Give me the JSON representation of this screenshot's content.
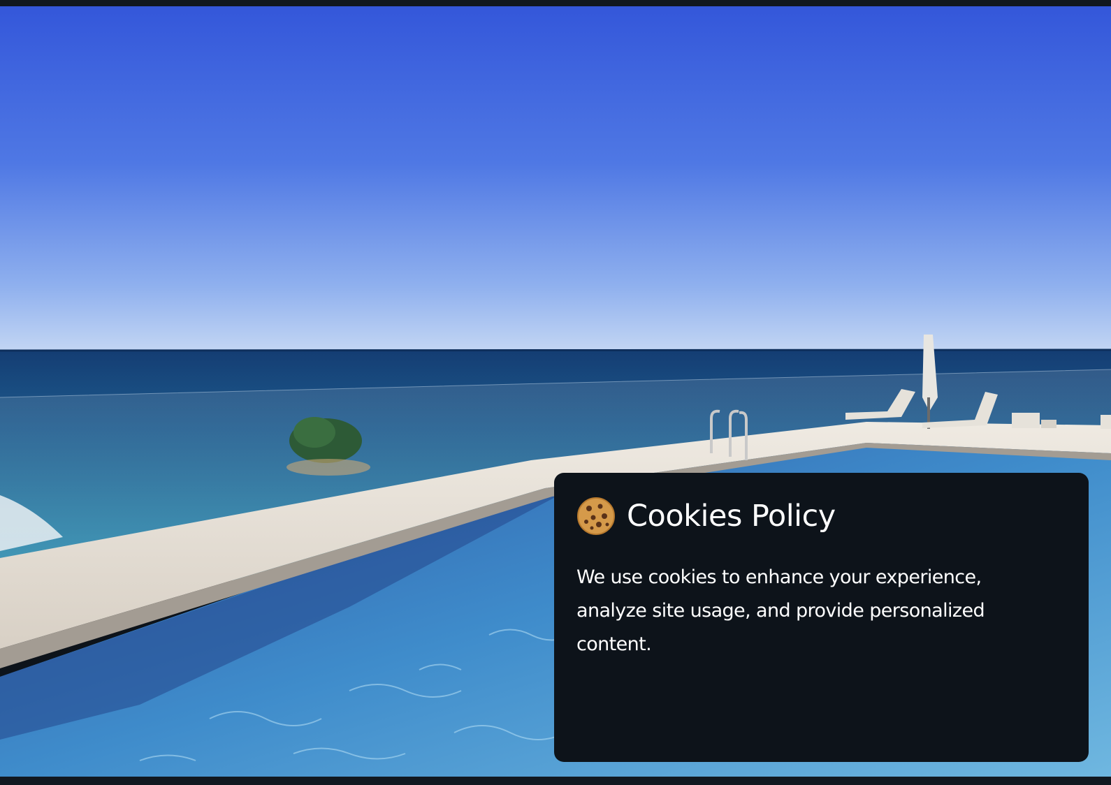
{
  "hero": {
    "image_description_icon": "pool-sea-view-photo"
  },
  "cookie_banner": {
    "icon": "cookie-icon",
    "title": "Cookies Policy",
    "message": "We use cookies to enhance your experience, analyze site usage, and provide personalized content."
  },
  "colors": {
    "dialog_background": "#0d131a",
    "sky_top": "#3a5ce0",
    "sea": "#1f5a8a",
    "pool": "#3f8cc9"
  }
}
